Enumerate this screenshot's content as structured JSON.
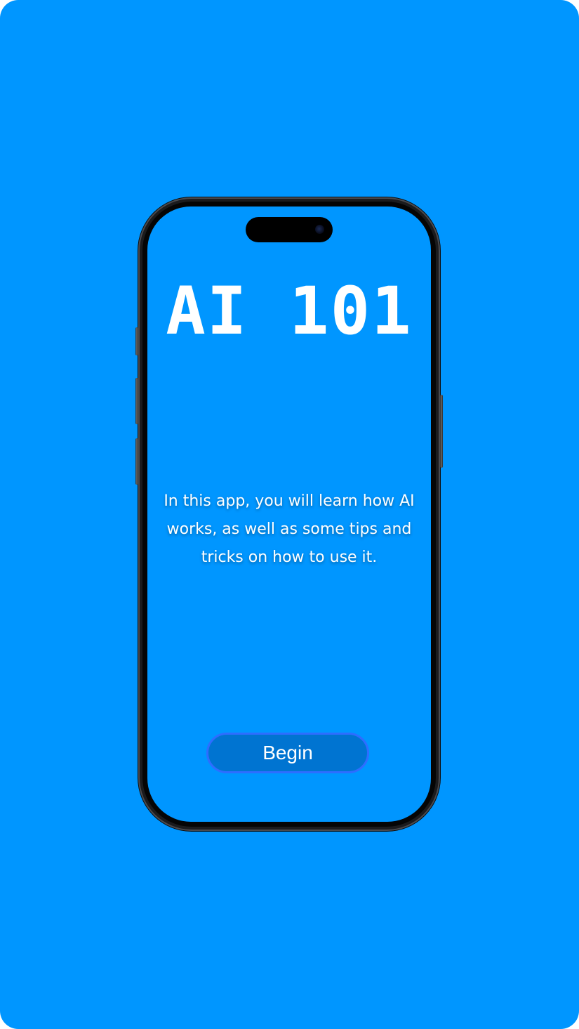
{
  "colors": {
    "background": "#0096FF",
    "screen": "#0096FF",
    "button_fill": "#0074D1",
    "button_border": "#2E6DFF",
    "text": "#FFFFFF",
    "phone_frame": "#1B1B1D"
  },
  "app": {
    "title": "AI 101",
    "description": "In this app, you will learn how AI works, as well as some tips and tricks on how to use it.",
    "begin_label": "Begin"
  },
  "device": {
    "icons": [
      "dynamic-island",
      "front-camera-icon"
    ]
  }
}
